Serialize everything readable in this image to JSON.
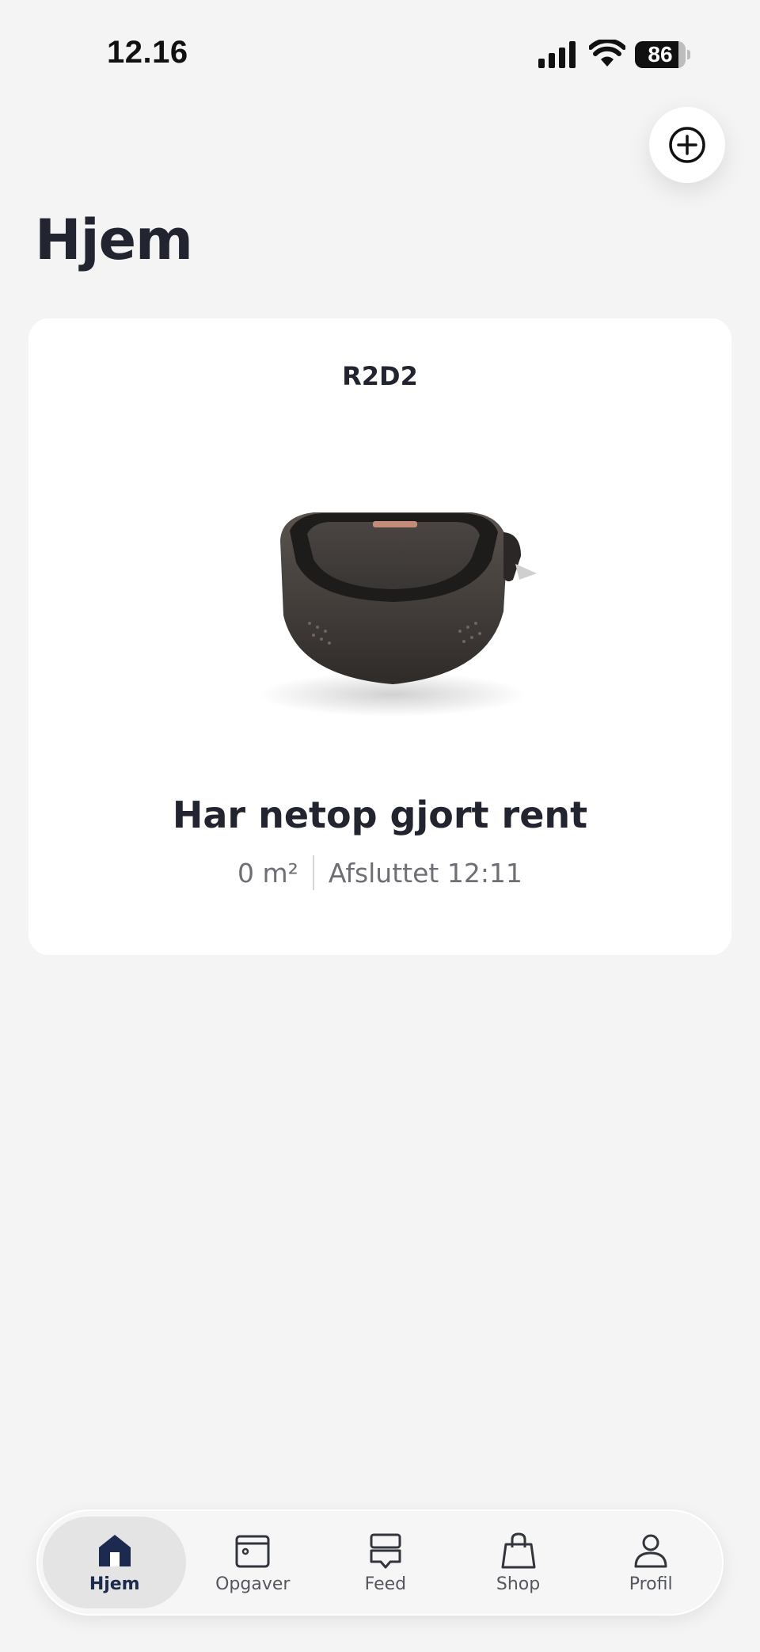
{
  "status_bar": {
    "time": "12.16",
    "battery_level": "86",
    "battery_fraction": 0.86
  },
  "header": {
    "title": "Hjem",
    "add_icon": "plus-circle-icon"
  },
  "device_card": {
    "name": "R2D2",
    "status": "Har netop gjort rent",
    "area": "0 m²",
    "finished": "Afsluttet 12:11"
  },
  "tab_bar": {
    "active_color": "#1b2a4e",
    "tabs": [
      {
        "label": "Hjem",
        "icon": "home-icon",
        "active": true
      },
      {
        "label": "Opgaver",
        "icon": "calendar-icon",
        "active": false
      },
      {
        "label": "Feed",
        "icon": "feed-icon",
        "active": false
      },
      {
        "label": "Shop",
        "icon": "shopping-bag-icon",
        "active": false
      },
      {
        "label": "Profil",
        "icon": "profile-icon",
        "active": false
      }
    ]
  }
}
